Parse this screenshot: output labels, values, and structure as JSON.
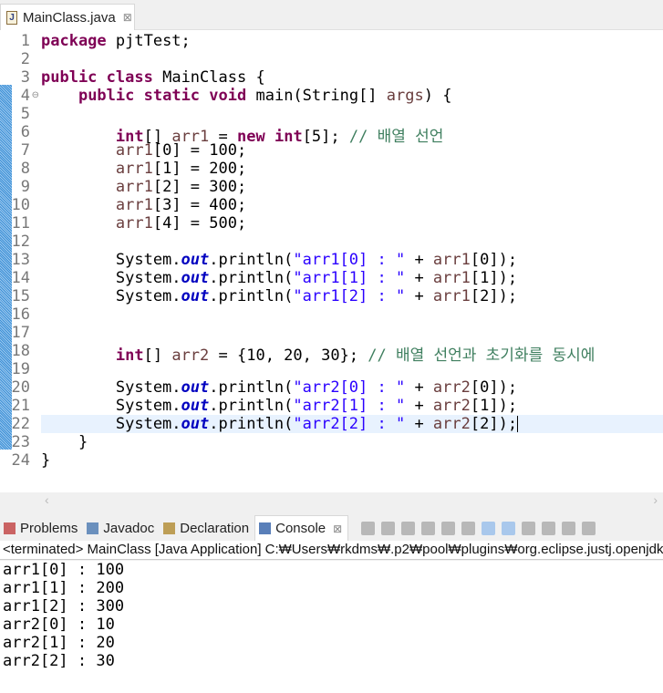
{
  "editor_tab": {
    "title": "MainClass.java",
    "close": "⊠"
  },
  "code": {
    "lines": [
      [
        [
          "package",
          "kw"
        ],
        [
          " pjtTest;",
          ""
        ]
      ],
      [],
      [
        [
          "public",
          "kw"
        ],
        [
          " ",
          ""
        ],
        [
          "class",
          "kw"
        ],
        [
          " MainClass {",
          ""
        ]
      ],
      [
        [
          "    ",
          ""
        ],
        [
          "public",
          "kw"
        ],
        [
          " ",
          ""
        ],
        [
          "static",
          "kw"
        ],
        [
          " ",
          ""
        ],
        [
          "void",
          "kw"
        ],
        [
          " main(String[] ",
          ""
        ],
        [
          "args",
          "var"
        ],
        [
          ") {",
          ""
        ]
      ],
      [],
      [
        [
          "        ",
          ""
        ],
        [
          "int",
          "kw"
        ],
        [
          "[] ",
          ""
        ],
        [
          "arr1",
          "var"
        ],
        [
          " = ",
          ""
        ],
        [
          "new",
          "kw"
        ],
        [
          " ",
          ""
        ],
        [
          "int",
          "kw"
        ],
        [
          "[5]; ",
          ""
        ],
        [
          "// 배열 선언",
          "cm"
        ]
      ],
      [
        [
          "        ",
          ""
        ],
        [
          "arr1",
          "var"
        ],
        [
          "[0] = 100;",
          ""
        ]
      ],
      [
        [
          "        ",
          ""
        ],
        [
          "arr1",
          "var"
        ],
        [
          "[1] = 200;",
          ""
        ]
      ],
      [
        [
          "        ",
          ""
        ],
        [
          "arr1",
          "var"
        ],
        [
          "[2] = 300;",
          ""
        ]
      ],
      [
        [
          "        ",
          ""
        ],
        [
          "arr1",
          "var"
        ],
        [
          "[3] = 400;",
          ""
        ]
      ],
      [
        [
          "        ",
          ""
        ],
        [
          "arr1",
          "var"
        ],
        [
          "[4] = 500;",
          ""
        ]
      ],
      [],
      [
        [
          "        System.",
          ""
        ],
        [
          "out",
          "fld"
        ],
        [
          ".println(",
          ""
        ],
        [
          "\"arr1[0] : \"",
          "str"
        ],
        [
          " + ",
          ""
        ],
        [
          "arr1",
          "var"
        ],
        [
          "[0]);",
          ""
        ]
      ],
      [
        [
          "        System.",
          ""
        ],
        [
          "out",
          "fld"
        ],
        [
          ".println(",
          ""
        ],
        [
          "\"arr1[1] : \"",
          "str"
        ],
        [
          " + ",
          ""
        ],
        [
          "arr1",
          "var"
        ],
        [
          "[1]);",
          ""
        ]
      ],
      [
        [
          "        System.",
          ""
        ],
        [
          "out",
          "fld"
        ],
        [
          ".println(",
          ""
        ],
        [
          "\"arr1[2] : \"",
          "str"
        ],
        [
          " + ",
          ""
        ],
        [
          "arr1",
          "var"
        ],
        [
          "[2]);",
          ""
        ]
      ],
      [],
      [],
      [
        [
          "        ",
          ""
        ],
        [
          "int",
          "kw"
        ],
        [
          "[] ",
          ""
        ],
        [
          "arr2",
          "var"
        ],
        [
          " = {10, 20, 30}; ",
          ""
        ],
        [
          "// 배열 선언과 초기화를 동시에",
          "cm"
        ]
      ],
      [],
      [
        [
          "        System.",
          ""
        ],
        [
          "out",
          "fld"
        ],
        [
          ".println(",
          ""
        ],
        [
          "\"arr2[0] : \"",
          "str"
        ],
        [
          " + ",
          ""
        ],
        [
          "arr2",
          "var"
        ],
        [
          "[0]);",
          ""
        ]
      ],
      [
        [
          "        System.",
          ""
        ],
        [
          "out",
          "fld"
        ],
        [
          ".println(",
          ""
        ],
        [
          "\"arr2[1] : \"",
          "str"
        ],
        [
          " + ",
          ""
        ],
        [
          "arr2",
          "var"
        ],
        [
          "[1]);",
          ""
        ]
      ],
      [
        [
          "        System.",
          ""
        ],
        [
          "out",
          "fld"
        ],
        [
          ".println(",
          ""
        ],
        [
          "\"arr2[2] : \"",
          "str"
        ],
        [
          " + ",
          ""
        ],
        [
          "arr2",
          "var"
        ],
        [
          "[2]);",
          ""
        ]
      ],
      [
        [
          "    }",
          ""
        ]
      ],
      [
        [
          "}",
          ""
        ]
      ]
    ],
    "current_line": 22
  },
  "views": {
    "tabs": [
      {
        "label": "Problems",
        "icon": "problems-icon",
        "color": "#c04040"
      },
      {
        "label": "Javadoc",
        "icon": "at-icon",
        "color": "#4a78b0"
      },
      {
        "label": "Declaration",
        "icon": "declaration-icon",
        "color": "#b08a30"
      },
      {
        "label": "Console",
        "icon": "console-icon",
        "color": "#2f5fa8",
        "active": true,
        "close": "⊠"
      }
    ]
  },
  "console": {
    "header": "<terminated> MainClass [Java Application] C:₩Users₩rkdms₩.p2₩pool₩plugins₩org.eclipse.justj.openjdk.hotspot.jre.full",
    "output": [
      "arr1[0] : 100",
      "arr1[1] : 200",
      "arr1[2] : 300",
      "arr2[0] : 10",
      "arr2[1] : 20",
      "arr2[2] : 30"
    ]
  }
}
